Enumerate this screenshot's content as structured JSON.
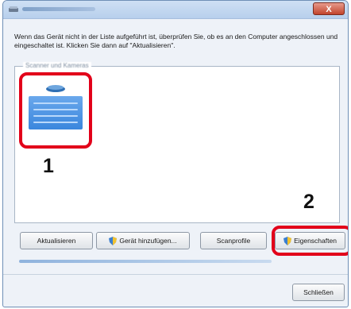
{
  "window": {
    "title": "",
    "close_label": "X"
  },
  "instruction": "Wenn das Gerät nicht in der Liste aufgeführt ist, überprüfen Sie, ob es an den Computer angeschlossen und eingeschaltet ist. Klicken Sie dann auf \"Aktualisieren\".",
  "device_group": {
    "label": "Scanner und Kameras",
    "items": [
      {
        "name": "",
        "icon": "scanner-icon",
        "selected": true
      }
    ]
  },
  "annotations": {
    "step1": "1",
    "step2": "2"
  },
  "buttons": {
    "refresh": "Aktualisieren",
    "add_device": "Gerät hinzufügen...",
    "scan_profiles": "Scanprofile",
    "properties": "Eigenschaften",
    "close": "Schließen"
  },
  "progress": {
    "value": 0.0
  },
  "colors": {
    "highlight": "#e2001a",
    "selection": "#3a86dd",
    "window_border": "#6f8fb6"
  }
}
